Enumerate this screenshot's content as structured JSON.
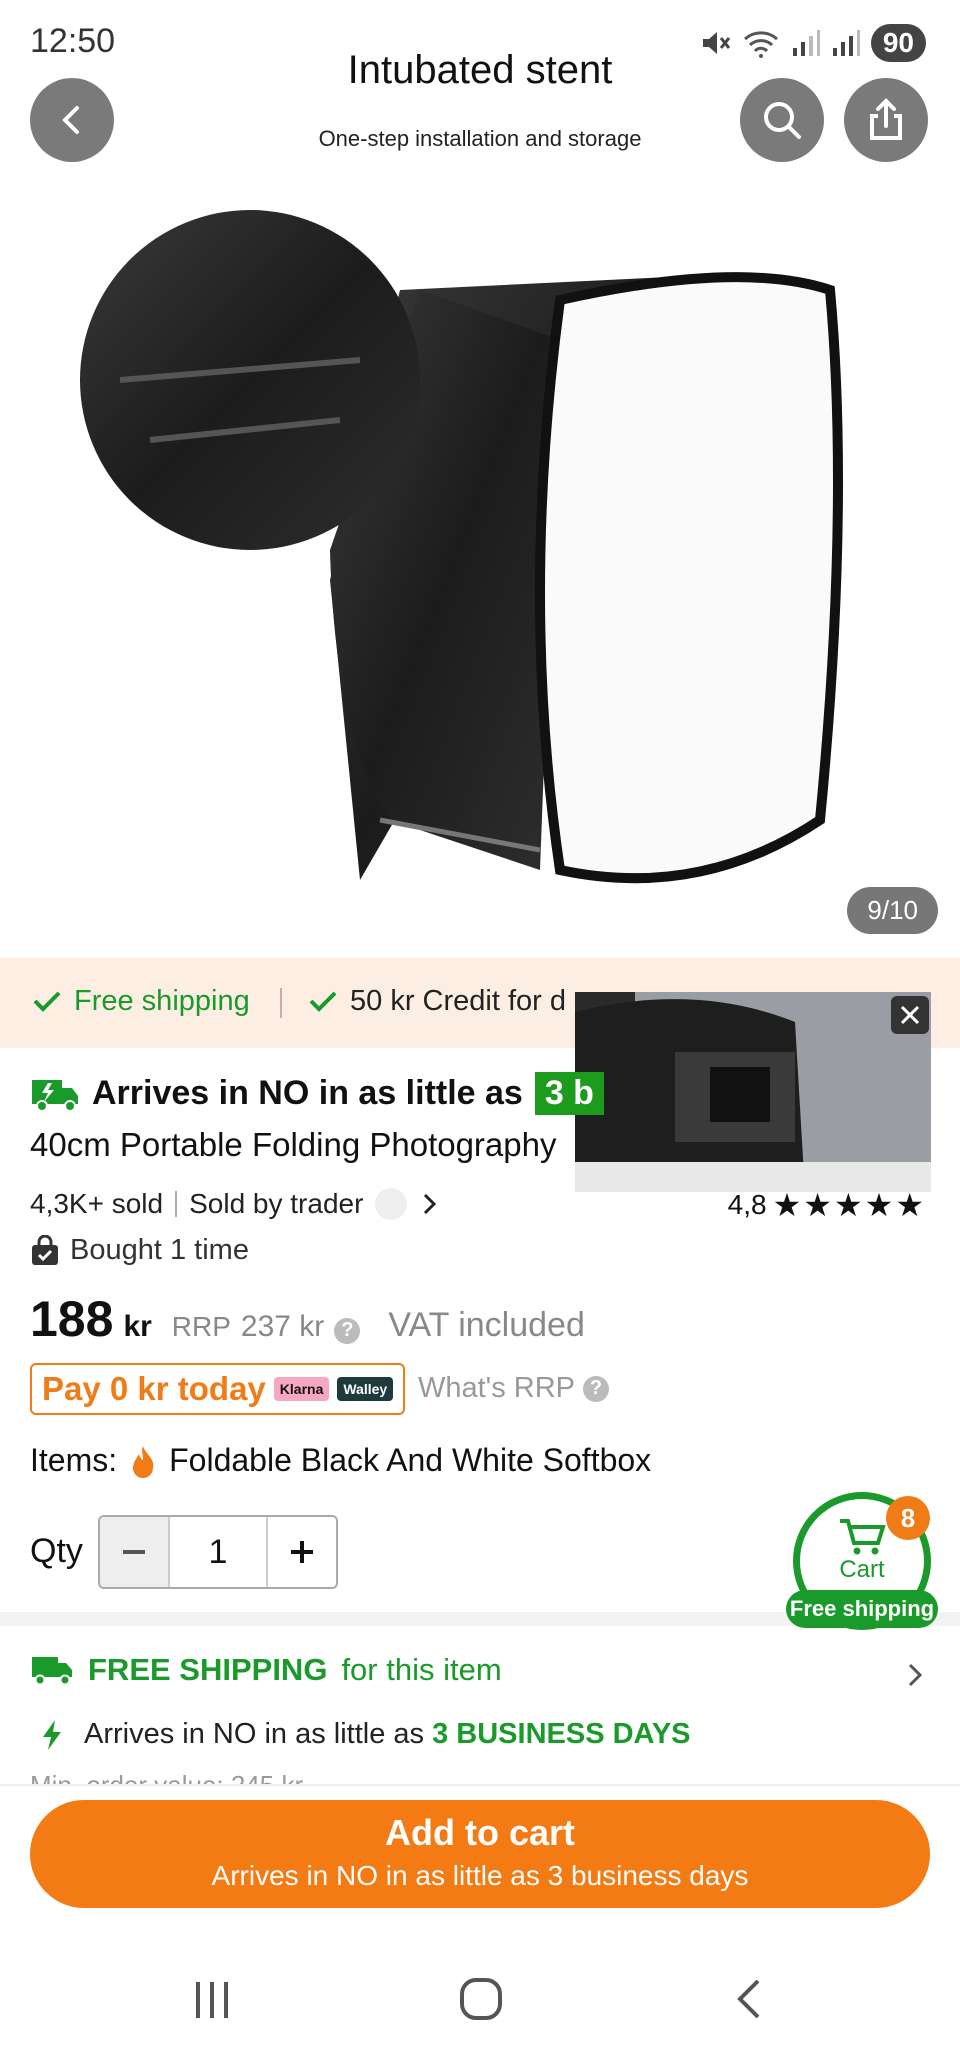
{
  "status_bar": {
    "time": "12:50",
    "battery": "90"
  },
  "header": {
    "title": "Intubated stent",
    "subtitle": "One-step installation and storage"
  },
  "gallery": {
    "counter": "9/10"
  },
  "benefits": [
    {
      "label": "Free shipping"
    },
    {
      "label": "50 kr Credit for d"
    }
  ],
  "product": {
    "arrive_prefix": "Arrives in NO in as little as",
    "arrive_badge": "3 b",
    "title": "40cm Portable Folding Photography",
    "sold": "4,3K+ sold",
    "sold_by": "Sold by trader",
    "rating": "4,8",
    "stars": "★★★★★",
    "bought": "Bought 1 time",
    "price": "188",
    "price_unit": "kr",
    "rrp_label": "RRP",
    "rrp_value": "237 kr",
    "vat": "VAT included",
    "pay_today": "Pay 0 kr today",
    "klarna": "Klarna",
    "walley": "Walley",
    "whats_rrp": "What's RRP",
    "items_label": "Items:",
    "item_value": "Foldable Black And White Softbox",
    "qty_label": "Qty",
    "qty_value": "1"
  },
  "cart": {
    "count": "8",
    "label": "Cart",
    "free": "Free shipping"
  },
  "shipping": {
    "free_prefix": "FREE SHIPPING",
    "free_suffix": "for this item",
    "arrive_prefix": "Arrives in NO in as little as",
    "arrive_days": "3 BUSINESS DAYS",
    "min_order": "Min. order value: 245 kr"
  },
  "cta": {
    "label": "Add to cart",
    "sub": "Arrives in NO in as little as 3 business days"
  },
  "colors": {
    "accent": "#f47a14",
    "green": "#1a9a2a"
  }
}
